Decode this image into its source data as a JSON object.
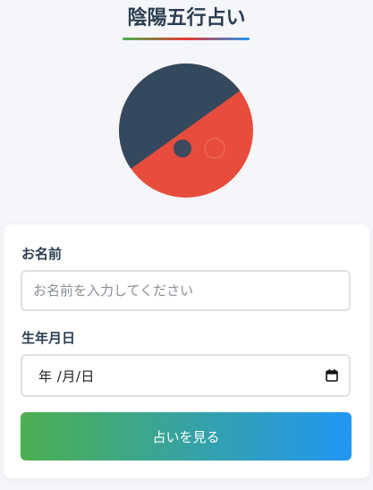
{
  "header": {
    "title": "陰陽五行占い"
  },
  "emblem": {
    "icon": "yin-yang-icon",
    "colors": {
      "dark": "#34495e",
      "light": "#e74c3c"
    }
  },
  "form": {
    "name_label": "お名前",
    "name_placeholder": "お名前を入力してください",
    "name_value": "",
    "birthdate_label": "生年月日",
    "birthdate_display": "年 /月/日",
    "submit_label": "占いを見る"
  },
  "colors": {
    "background": "#f4f6f9",
    "title_text": "#2c3e50",
    "button_gradient_start": "#4caf50",
    "button_gradient_end": "#2196f3"
  }
}
